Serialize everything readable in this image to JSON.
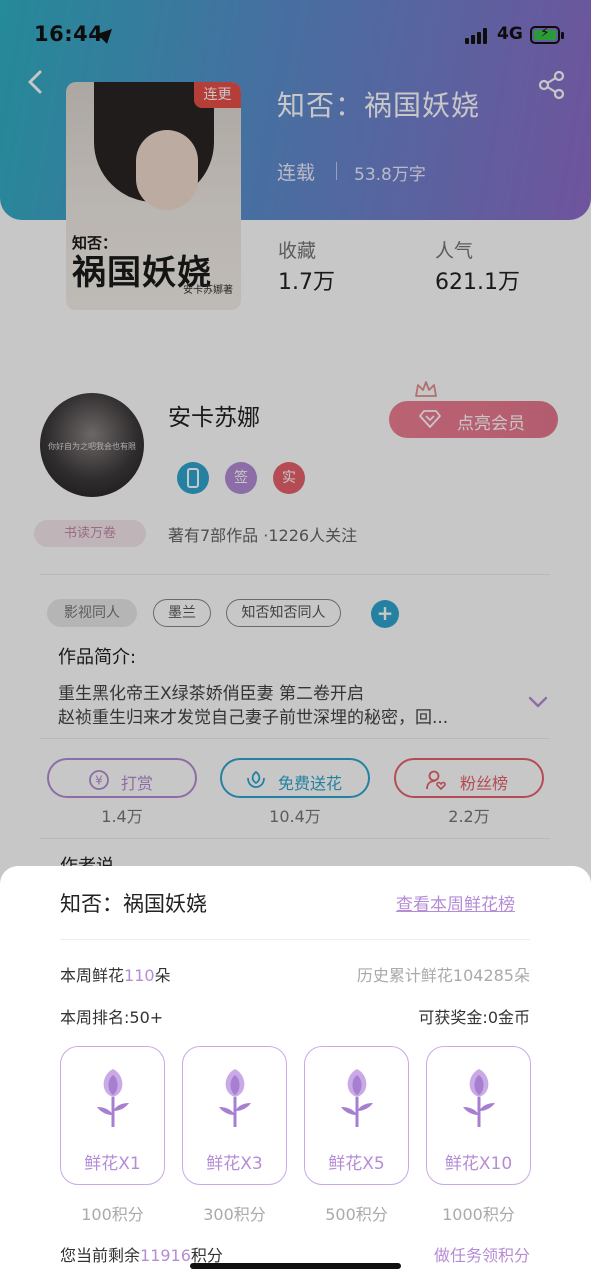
{
  "status_bar": {
    "time": "16:44",
    "network": "4G"
  },
  "book": {
    "title": "知否：祸国妖娆",
    "update_badge": "连更",
    "status": "连载",
    "word_count": "53.8万字",
    "cover": {
      "subtitle": "知否：",
      "title": "祸国妖娆",
      "author": "安卡苏娜著"
    },
    "stats": [
      {
        "label": "收藏",
        "value": "1.7万"
      },
      {
        "label": "人气",
        "value": "621.1万"
      }
    ]
  },
  "author": {
    "name": "安卡苏娜",
    "avatar_caption": "你好自为之吧我会也有限",
    "badges": [
      "签",
      "实"
    ],
    "vip_button": "点亮会员",
    "reader_badge": "书读万卷",
    "meta": "著有7部作品 ·1226人关注"
  },
  "tags": [
    "影视同人",
    "墨兰",
    "知否知否同人"
  ],
  "intro": {
    "label": "作品简介:",
    "lines": [
      "重生黑化帝王X绿茶娇俏臣妻 第二卷开启",
      "赵祯重生归来才发觉自己妻子前世深埋的秘密，回..."
    ]
  },
  "actions": [
    {
      "label": "打赏",
      "count": "1.4万",
      "color": "#b58cd6"
    },
    {
      "label": "免费送花",
      "count": "10.4万",
      "color": "#2fa6cf"
    },
    {
      "label": "粉丝榜",
      "count": "2.2万",
      "color": "#e8626e"
    }
  ],
  "section_stub": "作者说",
  "sheet": {
    "title": "知否：祸国妖娆",
    "link": "查看本周鲜花榜",
    "weekly_flowers_prefix": "本周鲜花",
    "weekly_flowers_value": "110",
    "weekly_flowers_suffix": "朵",
    "history_flowers": "历史累计鲜花104285朵",
    "weekly_rank": "本周排名:50+",
    "reward": "可获奖金:0金币",
    "options": [
      {
        "label": "鲜花X1",
        "cost": "100积分"
      },
      {
        "label": "鲜花X3",
        "cost": "300积分"
      },
      {
        "label": "鲜花X5",
        "cost": "500积分"
      },
      {
        "label": "鲜花X10",
        "cost": "1000积分"
      }
    ],
    "balance_prefix": "您当前剩余",
    "balance_value": "11916",
    "balance_suffix": "积分",
    "task_link": "做任务领积分"
  },
  "colors": {
    "accent": "#b58cd6",
    "header_start": "#2fb1c4",
    "header_end": "#8f6cc9",
    "badge_red": "#e8504a"
  },
  "icons": [
    "back-icon",
    "share-icon",
    "location-arrow-icon",
    "signal-icon",
    "battery-icon",
    "phone-icon",
    "diamond-icon",
    "crown-icon",
    "plus-icon",
    "chevron-down-icon",
    "coin-icon",
    "flower-outline-icon",
    "person-heart-icon",
    "flower-icon"
  ]
}
